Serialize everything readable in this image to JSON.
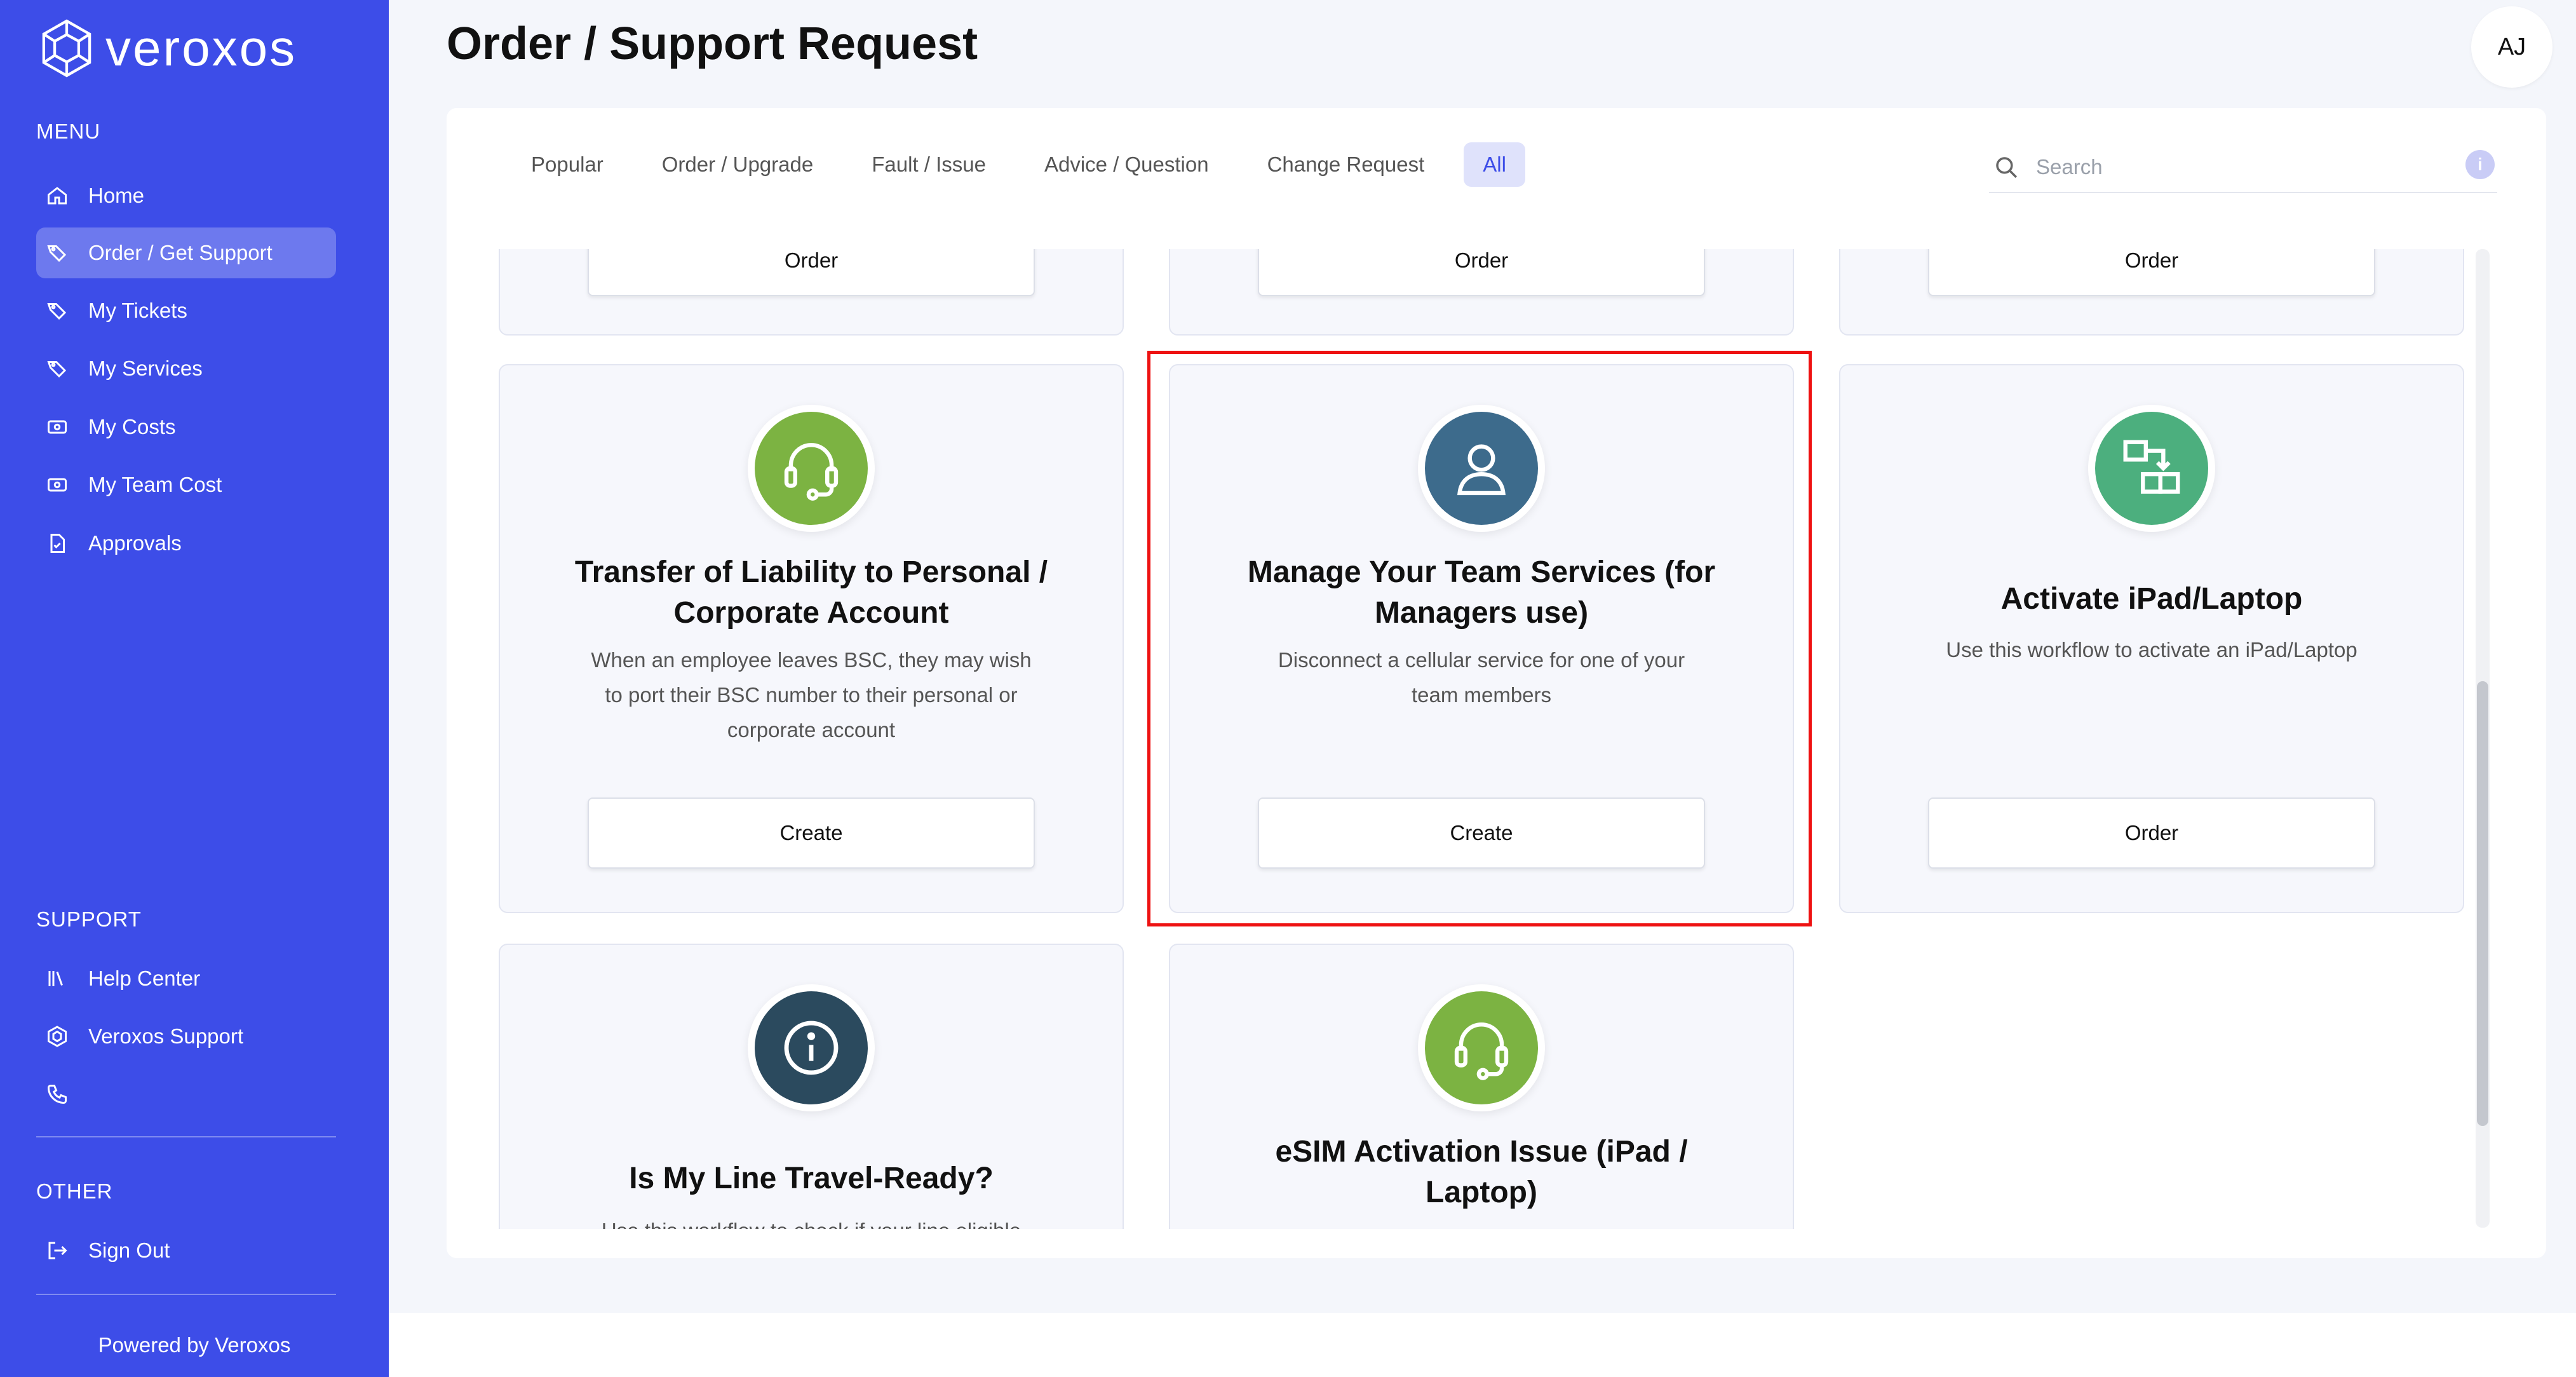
{
  "brand": {
    "name": "veroxos"
  },
  "sidebar": {
    "menu_title": "MENU",
    "menu_items": [
      {
        "label": "Home",
        "icon": "home-icon"
      },
      {
        "label": "Order / Get Support",
        "icon": "tag-icon",
        "active": true
      },
      {
        "label": "My Tickets",
        "icon": "tag-icon"
      },
      {
        "label": "My Services",
        "icon": "tag-icon"
      },
      {
        "label": "My Costs",
        "icon": "cash-icon"
      },
      {
        "label": "My Team Cost",
        "icon": "cash-icon"
      },
      {
        "label": "Approvals",
        "icon": "document-icon"
      }
    ],
    "support_title": "SUPPORT",
    "support_items": [
      {
        "label": "Help Center",
        "icon": "books-icon"
      },
      {
        "label": "Veroxos Support",
        "icon": "hexagon-icon"
      },
      {
        "label": "",
        "icon": "phone-icon"
      }
    ],
    "other_title": "OTHER",
    "other_items": [
      {
        "label": "Sign Out",
        "icon": "sign-out-icon"
      }
    ],
    "powered_by": "Powered by Veroxos"
  },
  "header": {
    "title": "Order / Support Request",
    "avatar_initials": "AJ"
  },
  "tabs": [
    {
      "label": "Popular"
    },
    {
      "label": "Order / Upgrade"
    },
    {
      "label": "Fault / Issue"
    },
    {
      "label": "Advice / Question"
    },
    {
      "label": "Change Request"
    },
    {
      "label": "All",
      "active": true
    }
  ],
  "search": {
    "placeholder": "Search",
    "info_icon_text": "i"
  },
  "cards": {
    "top_row": [
      {
        "button": "Order"
      },
      {
        "button": "Order"
      },
      {
        "button": "Order"
      }
    ],
    "transfer_liability": {
      "title_line1": "Transfer of Liability to Personal /",
      "title_line2": "Corporate Account",
      "desc_line1": "When an employee leaves BSC, they may wish",
      "desc_line2": "to port their BSC number to their personal or",
      "desc_line3": "corporate account",
      "button": "Create",
      "icon": "headset-icon",
      "icon_color": "#7cb342"
    },
    "manage_team": {
      "title_line1": "Manage Your Team Services (for",
      "title_line2": "Managers use)",
      "desc_line1": "Disconnect a cellular service for one of your",
      "desc_line2": "team members",
      "button": "Create",
      "icon": "user-icon",
      "icon_color": "#3d6b8c"
    },
    "activate_ipad": {
      "title": "Activate iPad/Laptop",
      "desc": "Use this workflow to activate an iPad/Laptop",
      "button": "Order",
      "icon": "workflow-icon",
      "icon_color": "#4caf7e"
    },
    "travel_ready": {
      "title": "Is My Line Travel-Ready?",
      "desc": "Use this workflow to check if your line eligible",
      "icon": "info-icon",
      "icon_color": "#2b4a5e"
    },
    "esim_issue": {
      "title_line1": "eSIM Activation Issue (iPad /",
      "title_line2": "Laptop)",
      "icon": "headset-icon",
      "icon_color": "#7cb342"
    }
  },
  "colors": {
    "sidebar": "#3d4de8",
    "highlight": "#e11111"
  }
}
